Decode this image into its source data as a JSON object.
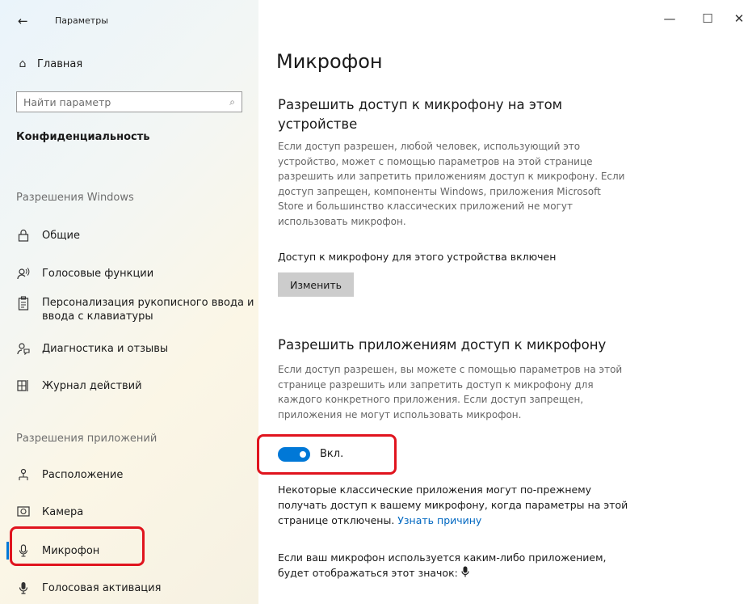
{
  "titlebar": {
    "back_icon": "back-arrow-icon",
    "title": "Параметры",
    "controls": {
      "minimize": "—",
      "maximize": "☐",
      "close": "✕"
    }
  },
  "sidebar": {
    "home": {
      "icon": "home-icon",
      "label": "Главная"
    },
    "search": {
      "placeholder": "Найти параметр",
      "icon": "search-icon"
    },
    "section_title": "Конфиденциальность",
    "group_windows": "Разрешения Windows",
    "windows_items": [
      {
        "icon": "lock-icon",
        "label": "Общие"
      },
      {
        "icon": "speech-icon",
        "label": "Голосовые функции"
      },
      {
        "icon": "handwriting-icon",
        "label": "Персонализация рукописного ввода и ввода с клавиатуры"
      },
      {
        "icon": "feedback-icon",
        "label": "Диагностика и отзывы"
      },
      {
        "icon": "timeline-icon",
        "label": "Журнал действий"
      }
    ],
    "group_apps": "Разрешения приложений",
    "app_items": [
      {
        "icon": "location-icon",
        "label": "Расположение"
      },
      {
        "icon": "camera-icon",
        "label": "Камера"
      },
      {
        "icon": "microphone-icon",
        "label": "Микрофон",
        "active": true
      },
      {
        "icon": "voice-activation-icon",
        "label": "Голосовая активация"
      }
    ]
  },
  "main": {
    "title": "Микрофон",
    "device_section": {
      "heading_line1": "Разрешить доступ к микрофону на этом",
      "heading_line2": "устройстве",
      "description": "Если доступ разрешен, любой человек, использующий это устройство, может с помощью параметров на этой странице разрешить или запретить приложениям доступ к микрофону. Если доступ запрещен, компоненты Windows, приложения Microsoft Store и большинство классических приложений не могут использовать микрофон.",
      "status": "Доступ к микрофону для этого устройства включен",
      "change_button": "Изменить"
    },
    "apps_section": {
      "heading": "Разрешить приложениям доступ к микрофону",
      "description": "Если доступ разрешен, вы можете с помощью параметров на этой странице разрешить или запретить доступ к микрофону для каждого конкретного приложения. Если доступ запрещен, приложения не могут использовать микрофон.",
      "toggle_state": "Вкл.",
      "toggle_on": true,
      "note": "Некоторые классические приложения могут по-прежнему получать доступ к вашему микрофону, когда параметры на этой странице отключены.",
      "note_link": "Узнать причину",
      "indicator_text": "Если ваш микрофон используется каким-либо приложением, будет отображаться этот значок:",
      "indicator_icon": "microphone-icon"
    }
  },
  "colors": {
    "accent": "#0078d7",
    "highlight": "#e0141e",
    "link": "#0067c0"
  }
}
